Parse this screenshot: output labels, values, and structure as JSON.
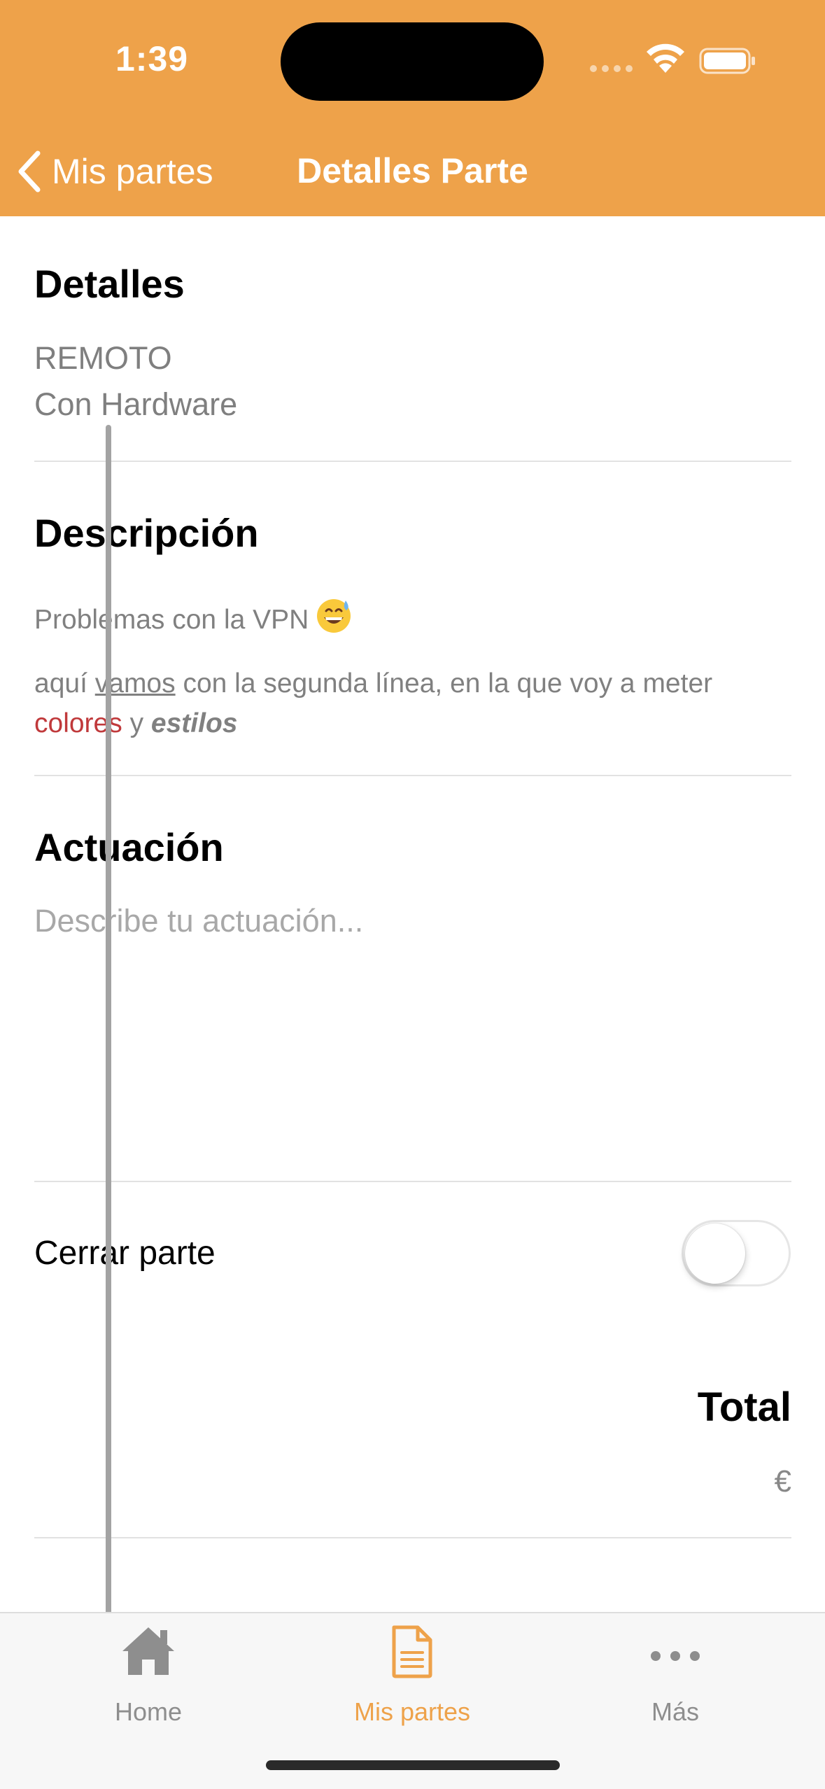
{
  "status_bar": {
    "time": "1:39"
  },
  "nav": {
    "back_label": "Mis partes",
    "title": "Detalles Parte"
  },
  "detalles": {
    "title": "Detalles",
    "lines": [
      "REMOTO",
      "Con Hardware"
    ]
  },
  "descripcion": {
    "title": "Descripción",
    "line1": "Problemas con la VPN",
    "line1_emoji": "grinning-sweat-emoji",
    "line2": {
      "part1": "aquí ",
      "underlined": "vamos",
      "part2": " con la segunda línea, en la que voy a meter"
    },
    "line3": {
      "red": "colores",
      "middle": " y ",
      "bold_italic": "estilos"
    }
  },
  "actuacion": {
    "title": "Actuación",
    "placeholder": "Describe tu actuación..."
  },
  "cerrar": {
    "label": "Cerrar parte",
    "on": false
  },
  "total": {
    "label": "Total",
    "currency": "€"
  },
  "tabs": [
    {
      "label": "Home",
      "icon": "house-icon",
      "active": false
    },
    {
      "label": "Mis partes",
      "icon": "document-icon",
      "active": true
    },
    {
      "label": "Más",
      "icon": "more-icon",
      "active": false
    }
  ],
  "colors": {
    "accent": "#EEA24A",
    "red_text": "#C0393B",
    "secondary_text": "#808080"
  }
}
